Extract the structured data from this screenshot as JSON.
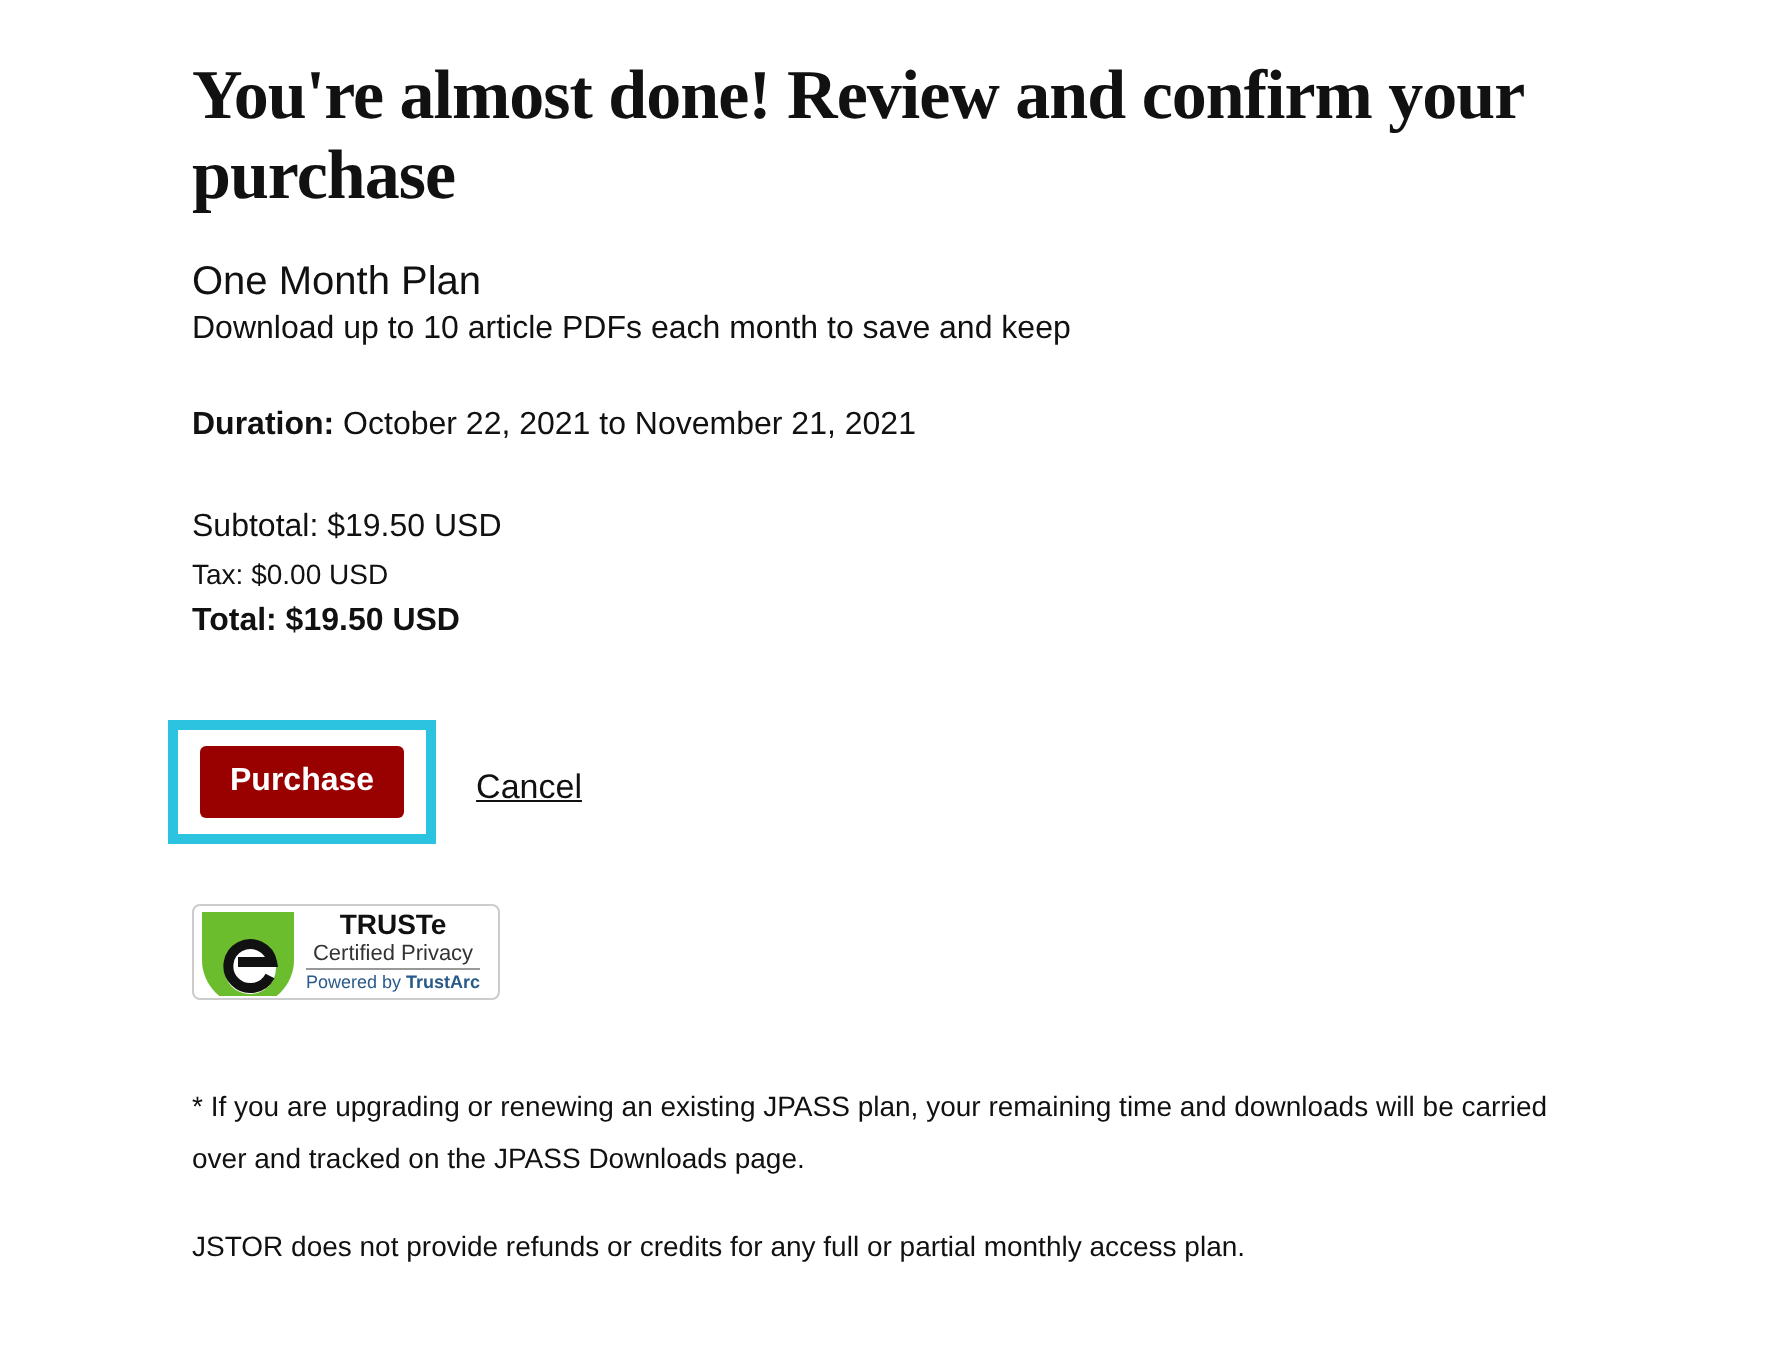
{
  "heading": "You're almost done! Review and confirm your purchase",
  "plan": {
    "name": "One Month Plan",
    "description": "Download up to 10 article PDFs each month to save and keep"
  },
  "duration": "**Duration:** October 22, 2021 to November 21, 2021",
  "summary": [
    {
      "kind": "subtotal",
      "text": "Subtotal: $19.50 USD"
    },
    {
      "kind": "tax",
      "text": "Tax: $0.00 USD"
    },
    {
      "kind": "total",
      "text": "Total: $19.50 USD"
    }
  ],
  "actions": {
    "purchase": "Purchase",
    "cancel": "Cancel",
    "purchase_highlighted": true
  },
  "badge": {
    "title": "TRUSTe",
    "subtitle": "Certified Privacy",
    "powered": "Powered by **TrustArc**"
  },
  "notes": [
    "* If you are upgrading or renewing an existing JPASS plan, your remaining time and downloads will be carried over and tracked on the JPASS Downloads page.",
    "JSTOR does not provide refunds or credits for any full or partial monthly access plan."
  ]
}
